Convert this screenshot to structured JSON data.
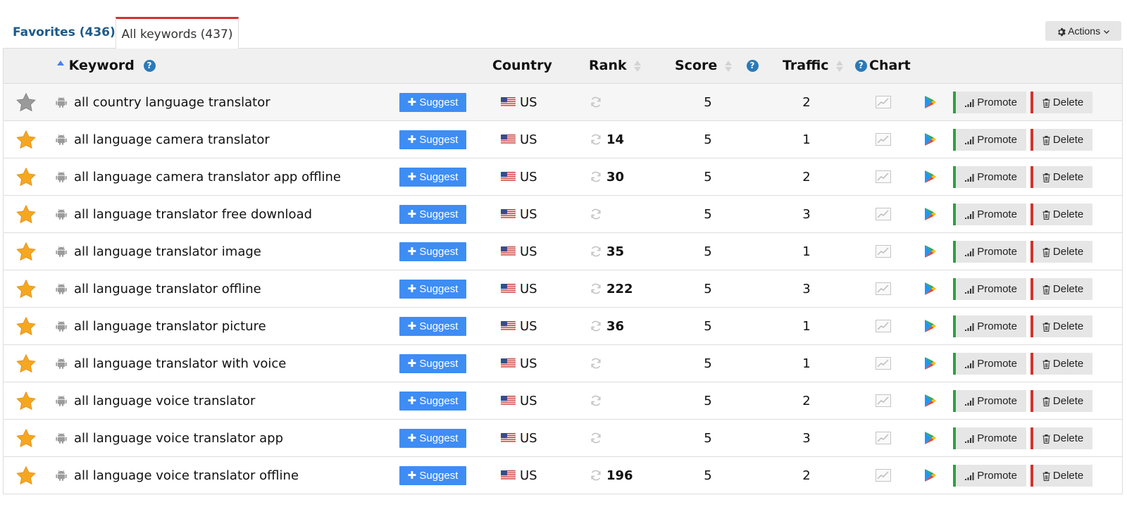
{
  "tabs": {
    "favorites": "Favorites (436)",
    "all": "All keywords (437)"
  },
  "actions_label": "Actions",
  "columns": {
    "keyword": "Keyword",
    "country": "Country",
    "rank": "Rank",
    "score": "Score",
    "traffic": "Traffic",
    "chart": "Chart"
  },
  "help_glyph": "?",
  "buttons": {
    "suggest": "Suggest",
    "promote": "Promote",
    "delete": "Delete"
  },
  "colors": {
    "suggest_bg": "#3d8df5",
    "promote_accent": "#2ea043",
    "delete_accent": "#d0342c",
    "active_tab_accent": "#d0342c",
    "star_active": "#f5a623",
    "star_inactive": "#9a9a9a"
  },
  "rows": [
    {
      "favorite": false,
      "keyword": "all country language translator",
      "country": "US",
      "rank": "",
      "score": "5",
      "traffic": "2"
    },
    {
      "favorite": true,
      "keyword": "all language camera translator",
      "country": "US",
      "rank": "14",
      "score": "5",
      "traffic": "1"
    },
    {
      "favorite": true,
      "keyword": "all language camera translator app offline",
      "country": "US",
      "rank": "30",
      "score": "5",
      "traffic": "2"
    },
    {
      "favorite": true,
      "keyword": "all language translator free download",
      "country": "US",
      "rank": "",
      "score": "5",
      "traffic": "3"
    },
    {
      "favorite": true,
      "keyword": "all language translator image",
      "country": "US",
      "rank": "35",
      "score": "5",
      "traffic": "1"
    },
    {
      "favorite": true,
      "keyword": "all language translator offline",
      "country": "US",
      "rank": "222",
      "score": "5",
      "traffic": "3"
    },
    {
      "favorite": true,
      "keyword": "all language translator picture",
      "country": "US",
      "rank": "36",
      "score": "5",
      "traffic": "1"
    },
    {
      "favorite": true,
      "keyword": "all language translator with voice",
      "country": "US",
      "rank": "",
      "score": "5",
      "traffic": "1"
    },
    {
      "favorite": true,
      "keyword": "all language voice translator",
      "country": "US",
      "rank": "",
      "score": "5",
      "traffic": "2"
    },
    {
      "favorite": true,
      "keyword": "all language voice translator app",
      "country": "US",
      "rank": "",
      "score": "5",
      "traffic": "3"
    },
    {
      "favorite": true,
      "keyword": "all language voice translator offline",
      "country": "US",
      "rank": "196",
      "score": "5",
      "traffic": "2"
    }
  ]
}
